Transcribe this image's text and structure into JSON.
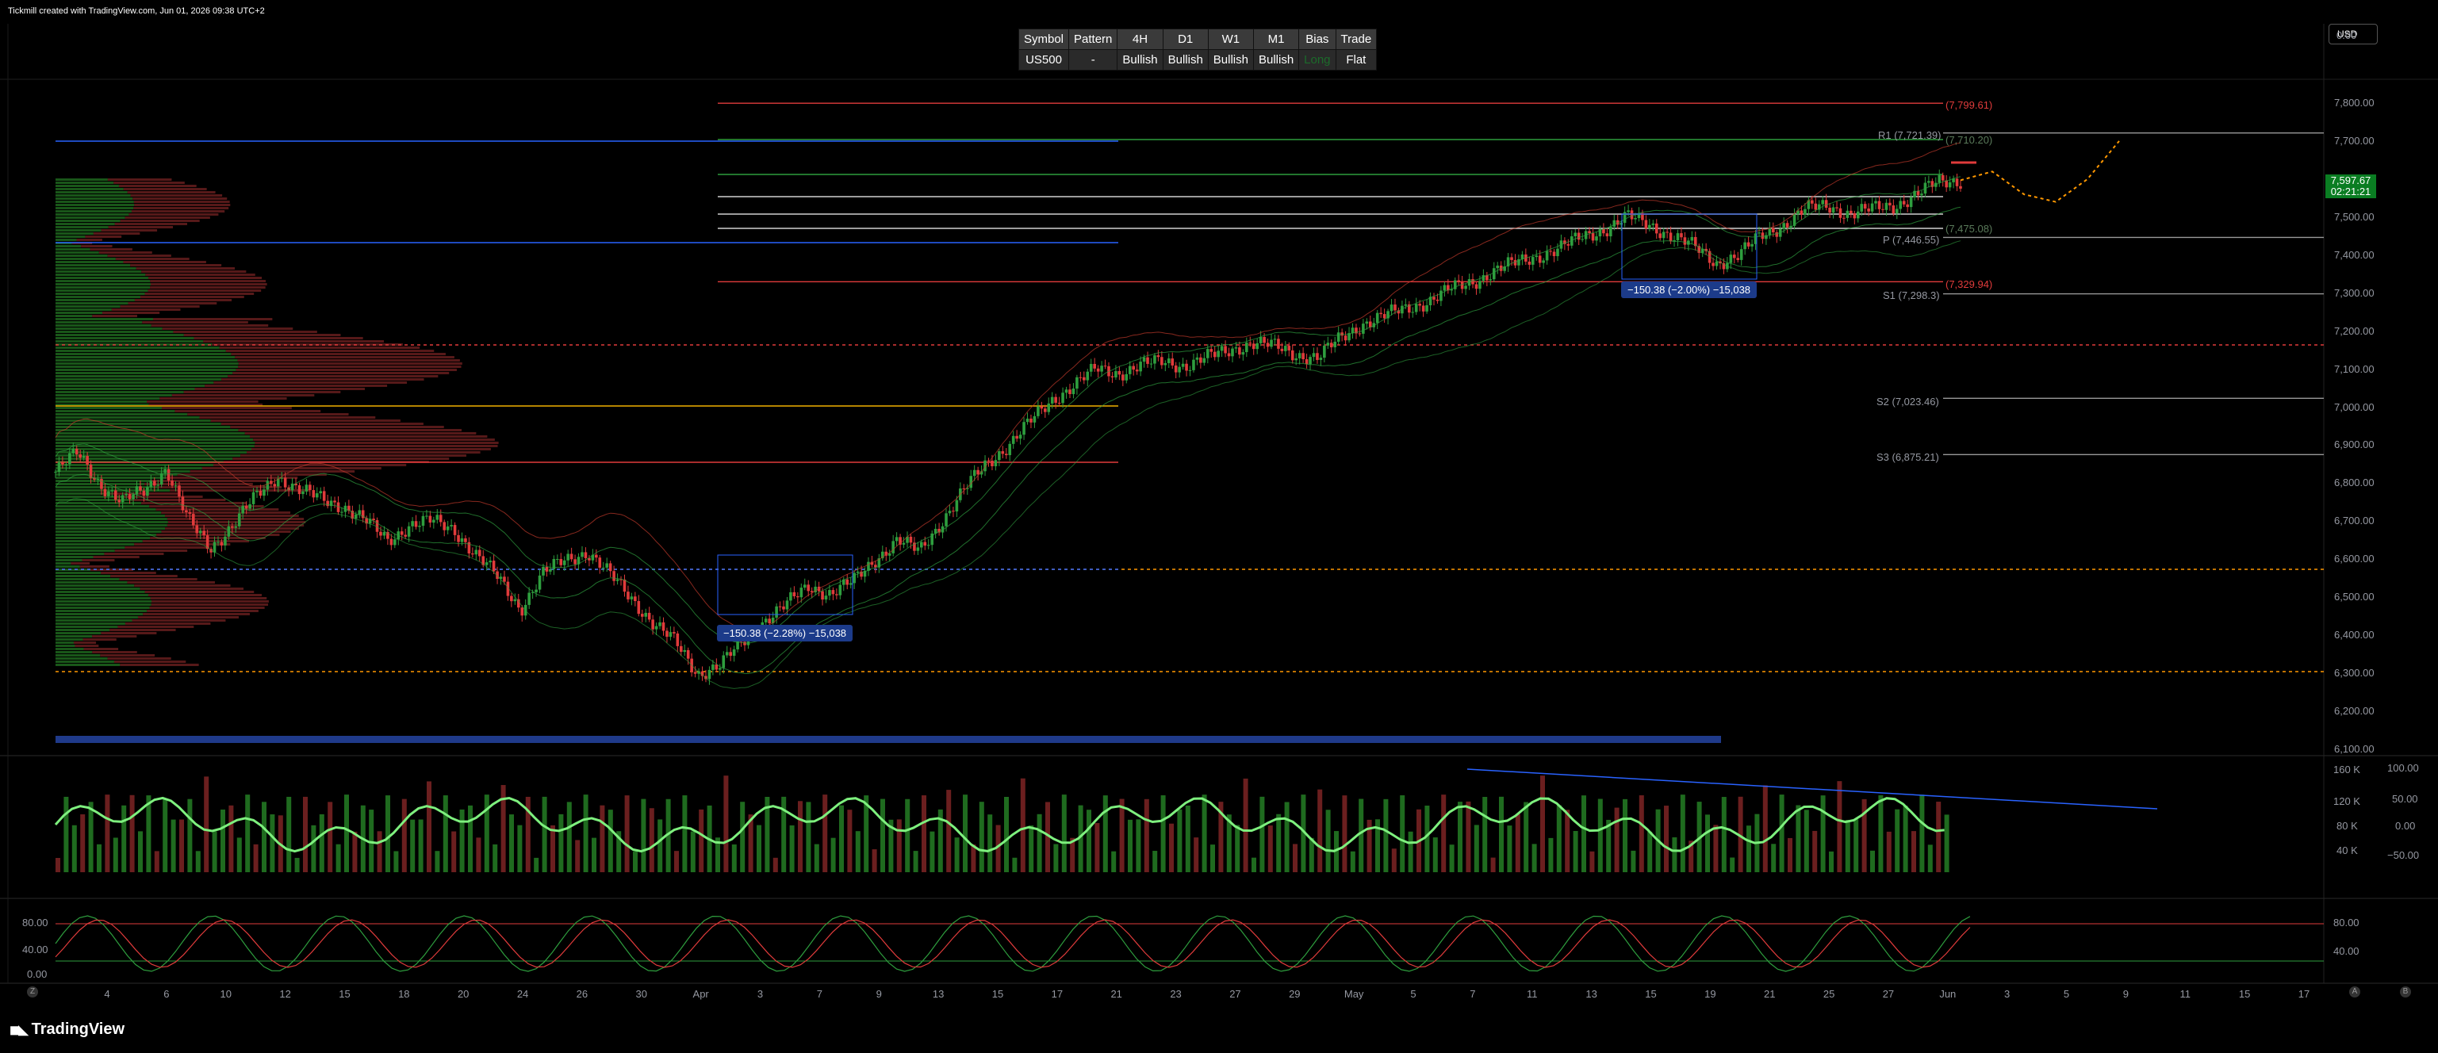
{
  "header": {
    "credit": "Tickmill created with TradingView.com, Jun 01, 2026 09:38 UTC+2"
  },
  "currency": "USD",
  "table": {
    "headers": [
      "Symbol",
      "Pattern",
      "4H",
      "D1",
      "W1",
      "M1",
      "Bias",
      "Trade"
    ],
    "row": [
      "US500",
      "-",
      "Bullish",
      "Bullish",
      "Bullish",
      "Bullish",
      "Long",
      "Flat"
    ]
  },
  "price_tag": {
    "price": "7,597.67",
    "countdown": "02:21:21"
  },
  "pivots": {
    "R2": "(7,799.61)",
    "R1": "R1 (7,721.39)",
    "R1b": "(7,710.20)",
    "P": "P (7,446.55)",
    "Pb": "(7,475.08)",
    "S1": "S1 (7,298.3)",
    "S1b": "(7,329.94)",
    "S2": "S2 (7,023.46)",
    "S3": "S3 (6,875.21)"
  },
  "measures": [
    "−150.38 (−2.28%) −15,038",
    "−150.38 (−2.00%) −15,038"
  ],
  "volume_axis": [
    "160 K",
    "120 K",
    "80 K",
    "40 K"
  ],
  "osc_axis": [
    "100.00",
    "50.00",
    "0.00",
    "−50.00"
  ],
  "stoch_axis": [
    "80.00",
    "40.00",
    "0.00"
  ],
  "stoch_axis_right": [
    "80.00",
    "40.00"
  ],
  "bottom_icons": [
    "Z",
    "A",
    "B"
  ],
  "brand": "TradingView",
  "colors": {
    "bull": "#2e9e3e",
    "bear": "#e03b3b",
    "blue": "#2962ff",
    "orange": "#ff9800",
    "bg": "#000000"
  },
  "chart_data": {
    "type": "candlestick",
    "symbol": "US500",
    "y_axis": {
      "ticks": [
        "7,800.00",
        "7,700.00",
        "7,600.00",
        "7,500.00",
        "7,400.00",
        "7,300.00",
        "7,200.00",
        "7,100.00",
        "7,000.00",
        "6,900.00",
        "6,800.00",
        "6,700.00",
        "6,600.00",
        "6,500.00",
        "6,400.00",
        "6,300.00",
        "6,200.00",
        "6,100.00"
      ],
      "range": [
        6100,
        7800
      ]
    },
    "x_axis": {
      "ticks": [
        "4",
        "6",
        "10",
        "12",
        "15",
        "18",
        "20",
        "24",
        "26",
        "30",
        "Apr",
        "3",
        "7",
        "9",
        "13",
        "15",
        "17",
        "21",
        "23",
        "27",
        "29",
        "May",
        "5",
        "7",
        "11",
        "13",
        "15",
        "19",
        "21",
        "25",
        "27",
        "Jun",
        "3",
        "5",
        "9",
        "11",
        "15",
        "17"
      ]
    },
    "top_axis_partial": "0.00",
    "close_path": [
      6830,
      6880,
      6800,
      6750,
      6780,
      6840,
      6700,
      6630,
      6690,
      6760,
      6820,
      6780,
      6760,
      6740,
      6700,
      6650,
      6690,
      6700,
      6680,
      6610,
      6550,
      6470,
      6560,
      6600,
      6620,
      6560,
      6500,
      6430,
      6380,
      6300,
      6320,
      6380,
      6440,
      6480,
      6530,
      6510,
      6540,
      6600,
      6650,
      6620,
      6700,
      6780,
      6850,
      6900,
      6960,
      7020,
      7060,
      7100,
      7090,
      7110,
      7120,
      7110,
      7130,
      7150,
      7170,
      7160,
      7140,
      7130,
      7180,
      7220,
      7240,
      7260,
      7280,
      7310,
      7330,
      7360,
      7380,
      7400,
      7420,
      7450,
      7470,
      7500,
      7480,
      7450,
      7420,
      7380,
      7400,
      7450,
      7480,
      7520,
      7530,
      7510,
      7520,
      7530,
      7560,
      7590,
      7597
    ],
    "forecast_path": [
      7597,
      7620,
      7560,
      7540,
      7600,
      7700
    ],
    "levels": [
      7799.61,
      7721.39,
      7710.2,
      7475.08,
      7446.55,
      7329.94,
      7298.3,
      7023.46,
      6875.21
    ],
    "current_price": 7597.67
  }
}
